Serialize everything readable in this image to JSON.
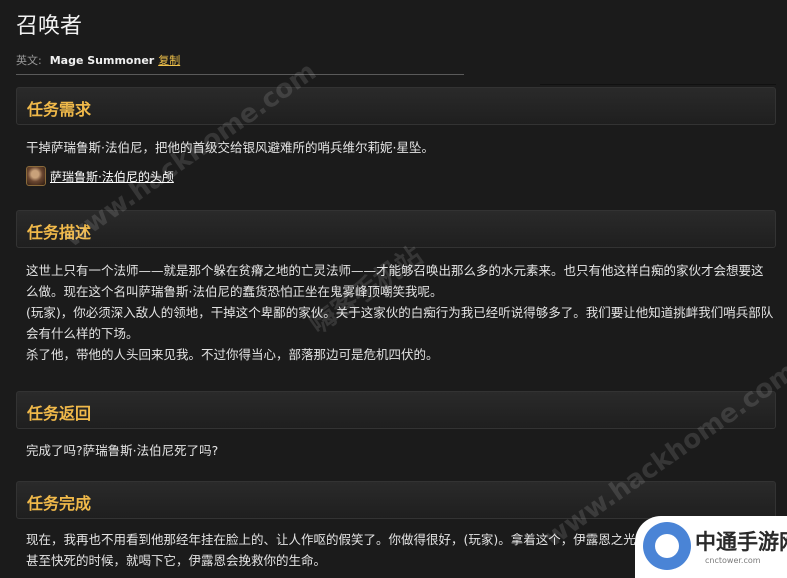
{
  "page": {
    "title": "召唤者",
    "en_label": "英文:",
    "en_name": "Mage Summoner",
    "copy_label": "复制"
  },
  "sections": {
    "requirement": {
      "heading": "任务需求",
      "text": "干掉萨瑞鲁斯·法伯尼，把他的首级交给银风避难所的哨兵维尔莉妮·星坠。",
      "item": "萨瑞鲁斯·法伯尼的头颅"
    },
    "description": {
      "heading": "任务描述",
      "lines": [
        "这世上只有一个法师——就是那个躲在贫瘠之地的亡灵法师——才能够召唤出那么多的水元素来。也只有他这样白痴的家伙才会想要这",
        "么做。现在这个名叫萨瑞鲁斯·法伯尼的蠢货恐怕正坐在鬼雾峰顶嘲笑我呢。",
        "(玩家)，你必须深入敌人的领地，干掉这个卑鄙的家伙。关于这家伙的白痴行为我已经听说得够多了。我们要让他知道挑衅我们哨兵部队",
        "会有什么样的下场。",
        "杀了他，带他的人头回来见我。不过你得当心，部落那边可是危机四伏的。"
      ]
    },
    "return": {
      "heading": "任务返回",
      "text": "完成了吗?萨瑞鲁斯·法伯尼死了吗?"
    },
    "complete": {
      "heading": "任务完成",
      "lines": [
        "现在，我再也不用看到他那经年挂在脸上的、让人作呕的假笑了。你做得很好，(玩家)。拿着这个，伊露恩之光，当你在战斗中将要落败",
        "甚至快死的时候，就喝下它，伊露恩会挽救你的生命。"
      ]
    }
  },
  "watermark": {
    "text1": "www.hackhome.com",
    "text2": "嗨客手机站",
    "text3": "www.hackhome.com"
  },
  "badge": {
    "name": "中通手游网",
    "url": "cnctower.com"
  }
}
